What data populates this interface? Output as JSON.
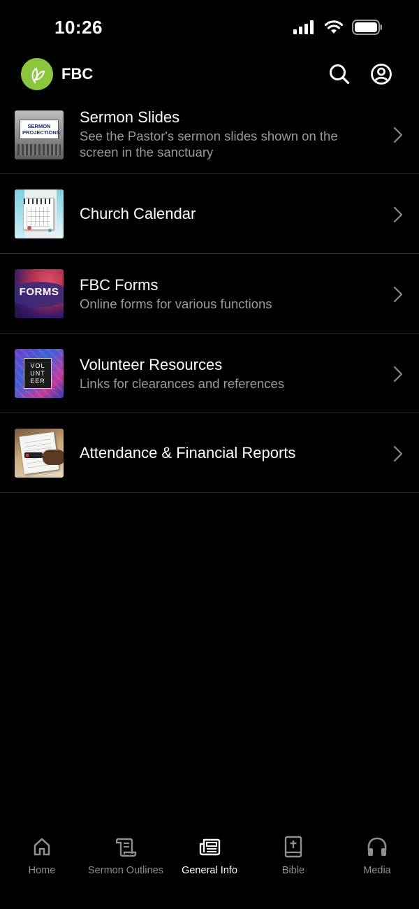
{
  "status": {
    "time": "10:26"
  },
  "header": {
    "title": "FBC"
  },
  "items": [
    {
      "title": "Sermon Slides",
      "subtitle": "See the Pastor's sermon slides shown on the screen in the sanctuary",
      "thumb_text": "SERMON PROJECTIONS"
    },
    {
      "title": "Church Calendar",
      "subtitle": ""
    },
    {
      "title": "FBC Forms",
      "subtitle": "Online forms for various functions",
      "thumb_text": "FORMS"
    },
    {
      "title": "Volunteer Resources",
      "subtitle": "Links for clearances and references",
      "thumb_text": "VOLUNTEER"
    },
    {
      "title": "Attendance & Financial Reports",
      "subtitle": ""
    }
  ],
  "tabs": [
    {
      "label": "Home",
      "icon": "home-icon"
    },
    {
      "label": "Sermon Outlines",
      "icon": "scroll-icon"
    },
    {
      "label": "General Info",
      "icon": "news-icon",
      "active": true
    },
    {
      "label": "Bible",
      "icon": "bible-icon"
    },
    {
      "label": "Media",
      "icon": "headphones-icon"
    }
  ],
  "colors": {
    "background": "#000000",
    "logo": "#8cc63f",
    "subtitle": "#9a9a9a",
    "tab_inactive": "#8e8e8e"
  }
}
